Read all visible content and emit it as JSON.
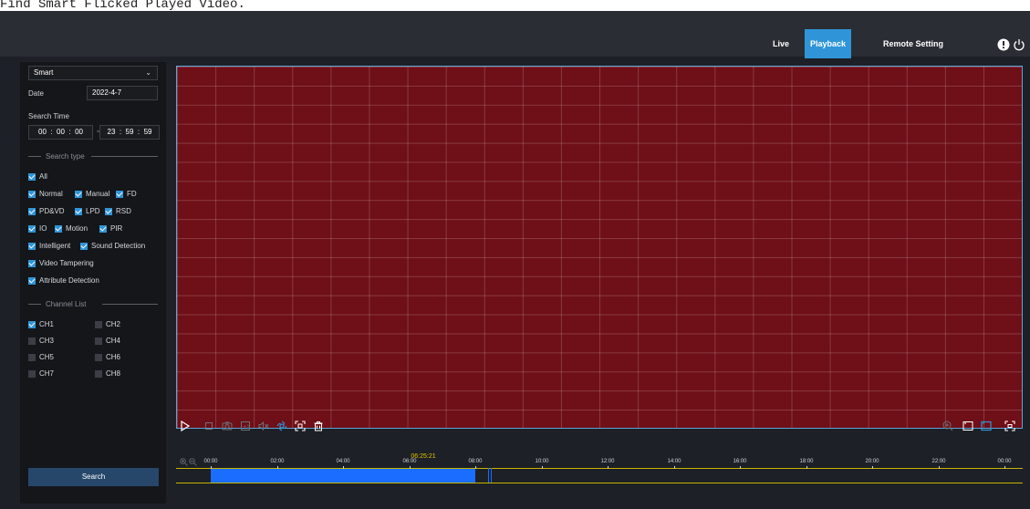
{
  "caption": "Find Smart Flicked Played Video.",
  "nav": {
    "live": "Live",
    "playback": "Playback",
    "remote_setting": "Remote Setting",
    "icons": [
      "alert-icon",
      "power-icon"
    ]
  },
  "sidebar": {
    "mode_select": "Smart",
    "date_label": "Date",
    "date_value": "2022-4-7",
    "search_time_label": "Search Time",
    "start_time": {
      "h": "00",
      "m": "00",
      "s": "00"
    },
    "end_time": {
      "h": "23",
      "m": "59",
      "s": "59"
    },
    "range_sep": "~",
    "colon": ":",
    "search_type_title": "Search type",
    "search_types": [
      {
        "label": "All",
        "checked": true
      },
      {
        "label": "Normal",
        "checked": true
      },
      {
        "label": "Manual",
        "checked": true
      },
      {
        "label": "FD",
        "checked": true
      },
      {
        "label": "PD&VD",
        "checked": true
      },
      {
        "label": "LPD",
        "checked": true
      },
      {
        "label": "RSD",
        "checked": true
      },
      {
        "label": "IO",
        "checked": true
      },
      {
        "label": "Motion",
        "checked": true
      },
      {
        "label": "PIR",
        "checked": true
      },
      {
        "label": "Intelligent",
        "checked": true
      },
      {
        "label": "Sound Detection",
        "checked": true
      },
      {
        "label": "Video Tampering",
        "checked": true
      },
      {
        "label": "Attribute Detection",
        "checked": true
      }
    ],
    "channel_list_title": "Channel List",
    "channels": [
      {
        "label": "CH1",
        "checked": true
      },
      {
        "label": "CH2",
        "checked": false
      },
      {
        "label": "CH3",
        "checked": false
      },
      {
        "label": "CH4",
        "checked": false
      },
      {
        "label": "CH5",
        "checked": false
      },
      {
        "label": "CH6",
        "checked": false
      },
      {
        "label": "CH7",
        "checked": false
      },
      {
        "label": "CH8",
        "checked": false
      }
    ],
    "search_button": "Search"
  },
  "timeline": {
    "cursor_time": "06:25:21",
    "ticks": [
      "00:00",
      "02:00",
      "04:00",
      "06:00",
      "08:00",
      "10:00",
      "12:00",
      "14:00",
      "16:00",
      "18:00",
      "20:00",
      "22:00",
      "00:00"
    ]
  },
  "colors": {
    "accent": "#2f95d8",
    "video_background": "#6f0f17",
    "recording": "#1a6dff",
    "cursor": "#e3c400"
  }
}
